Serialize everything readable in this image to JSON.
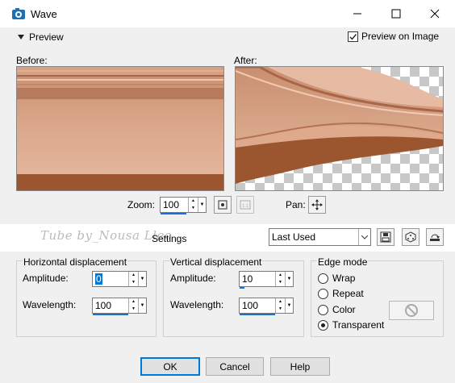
{
  "window": {
    "title": "Wave"
  },
  "preview": {
    "toggle_label": "Preview",
    "on_image_label": "Preview on Image",
    "on_image_checked": true,
    "before_label": "Before:",
    "after_label": "After:",
    "zoom_label": "Zoom:",
    "zoom_value": "100",
    "pan_label": "Pan:"
  },
  "settings": {
    "label": "Settings",
    "watermark": "Tube by_Nousa Lleo",
    "preset_value": "Last Used"
  },
  "horizontal": {
    "title": "Horizontal displacement",
    "amplitude_label": "Amplitude:",
    "amplitude_value": "0",
    "wavelength_label": "Wavelength:",
    "wavelength_value": "100"
  },
  "vertical": {
    "title": "Vertical displacement",
    "amplitude_label": "Amplitude:",
    "amplitude_value": "10",
    "wavelength_label": "Wavelength:",
    "wavelength_value": "100"
  },
  "edge_mode": {
    "title": "Edge mode",
    "options": [
      "Wrap",
      "Repeat",
      "Color",
      "Transparent"
    ],
    "selected": "Transparent"
  },
  "buttons": {
    "ok": "OK",
    "cancel": "Cancel",
    "help": "Help"
  },
  "colors": {
    "accent": "#0078d7",
    "preview_brown": "#b8704a"
  }
}
